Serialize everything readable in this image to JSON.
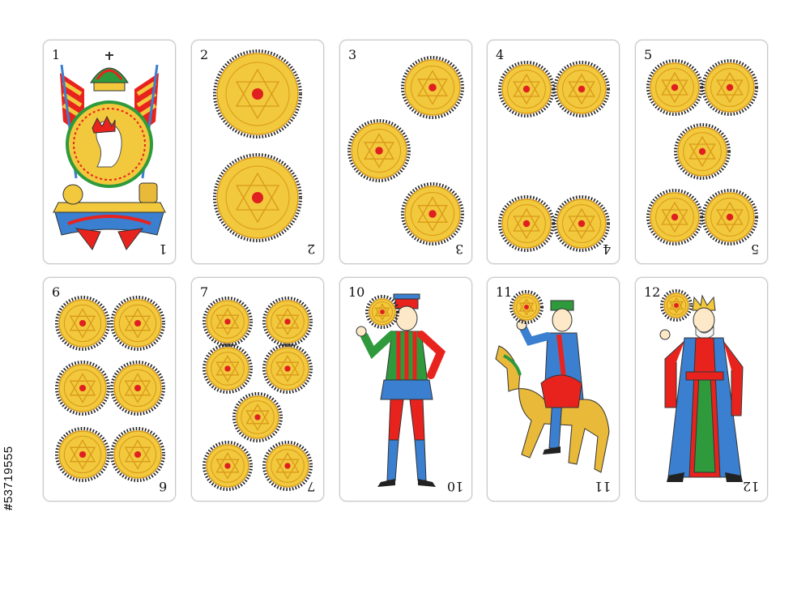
{
  "cards": [
    {
      "id": "card-1",
      "rank": "1",
      "rank_bottom": "1",
      "coins": 0
    },
    {
      "id": "card-2",
      "rank": "2",
      "rank_bottom": "2",
      "coins": 2
    },
    {
      "id": "card-3",
      "rank": "3",
      "rank_bottom": "3",
      "coins": 3
    },
    {
      "id": "card-4",
      "rank": "4",
      "rank_bottom": "4",
      "coins": 4
    },
    {
      "id": "card-5",
      "rank": "5",
      "rank_bottom": "5",
      "coins": 5
    },
    {
      "id": "card-6",
      "rank": "6",
      "rank_bottom": "6",
      "coins": 6
    },
    {
      "id": "card-7",
      "rank": "7",
      "rank_bottom": "7",
      "coins": 7
    },
    {
      "id": "card-10",
      "rank": "10",
      "rank_bottom": "10",
      "coins": 1
    },
    {
      "id": "card-11",
      "rank": "11",
      "rank_bottom": "11",
      "coins": 1
    },
    {
      "id": "card-12",
      "rank": "12",
      "rank_bottom": "12",
      "coins": 1
    }
  ],
  "colors": {
    "coin_fill": "#f2c83c",
    "coin_ring": "#d99a1a",
    "coin_spikes": "#222222",
    "coin_center": "#e02020",
    "red": "#e8231e",
    "blue": "#3a7fd0",
    "green": "#2e9a3c",
    "gold": "#e9b93a"
  },
  "side_label": {
    "prefix": "#",
    "number": "53719555"
  }
}
